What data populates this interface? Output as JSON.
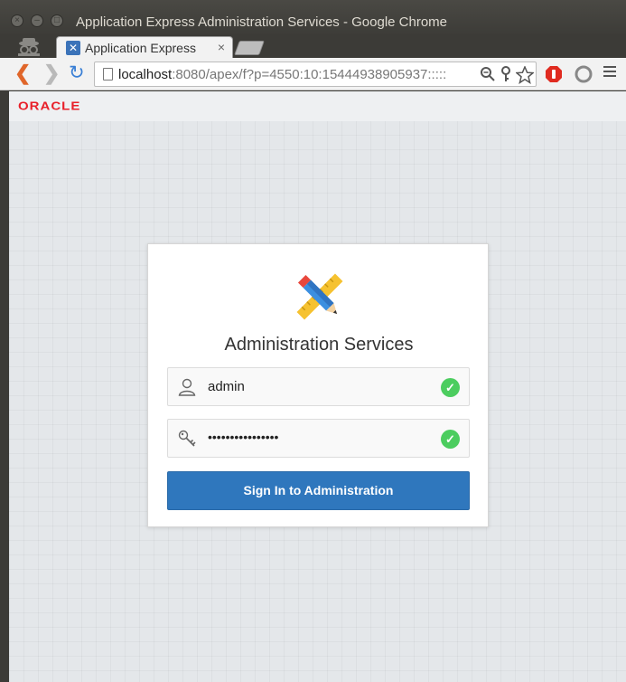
{
  "window": {
    "title": "Application Express Administration Services - Google Chrome"
  },
  "tab": {
    "title": "Application Express",
    "close_glyph": "×"
  },
  "toolbar": {
    "url_host": "localhost",
    "url_rest": ":8080/apex/f?p=4550:10:15444938905937:::::"
  },
  "header": {
    "logo_text": "ORACLE"
  },
  "login": {
    "title": "Administration Services",
    "username_value": "admin",
    "password_value": "••••••••••••••••",
    "submit_label": "Sign In to Administration"
  },
  "colors": {
    "brand_red": "#e8202a",
    "primary_button": "#2f77bd",
    "valid_check": "#4ccd5f"
  },
  "icons": {
    "app": "pencil-ruler-icon",
    "user": "user-icon",
    "password": "key-icon",
    "valid": "check-icon"
  }
}
